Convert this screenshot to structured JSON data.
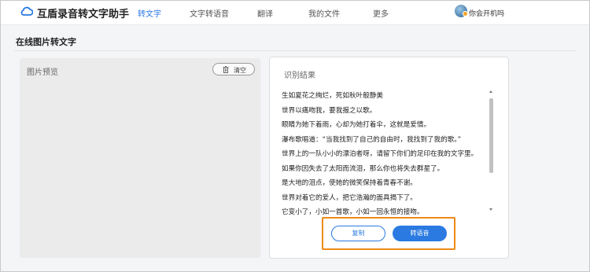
{
  "header": {
    "app_title": "互盾录音转文字助手",
    "logo_icon": "cloud-logo-icon",
    "nav": [
      {
        "label": "转文字",
        "active": true
      },
      {
        "label": "文字转语音",
        "active": false
      },
      {
        "label": "翻译",
        "active": false
      },
      {
        "label": "我的文件",
        "active": false
      },
      {
        "label": "更多",
        "active": false
      }
    ],
    "user": {
      "name": "你会开机吗",
      "avatar_icon": "user-avatar-icon"
    }
  },
  "page": {
    "heading": "在线图片转文字"
  },
  "preview": {
    "title": "图片预览",
    "clear_button": {
      "label": "清空",
      "icon": "trash-icon"
    }
  },
  "result": {
    "title": "识别结果",
    "lines": [
      "生如夏花之绚烂，死如秋叶般静美",
      "世界以痛吻我，要我报之以歌。",
      "眼睛为她下着雨，心却为她打着伞，这就是爱情。",
      "瀑布歌唱道：“当我找到了自己的自由时，我找到了我的歌。”",
      "世界上的一队小小的漂泊者呀，请留下你们的足印在我的文字里。",
      "如果你因失去了太阳而流泪，那么你也将失去群星了。",
      "是大地的泪点，使她的微笑保持着青春不谢。",
      "世界对着它的爱人，把它浩瀚的面具揭下了。",
      "它变小了，小如一首歌，小如一回永恒的接吻。"
    ],
    "copy_label": "复制",
    "tts_label": "转语音"
  },
  "colors": {
    "accent": "#2a7ae2",
    "highlight": "#ef8a17",
    "background": "#f4f5f7"
  }
}
